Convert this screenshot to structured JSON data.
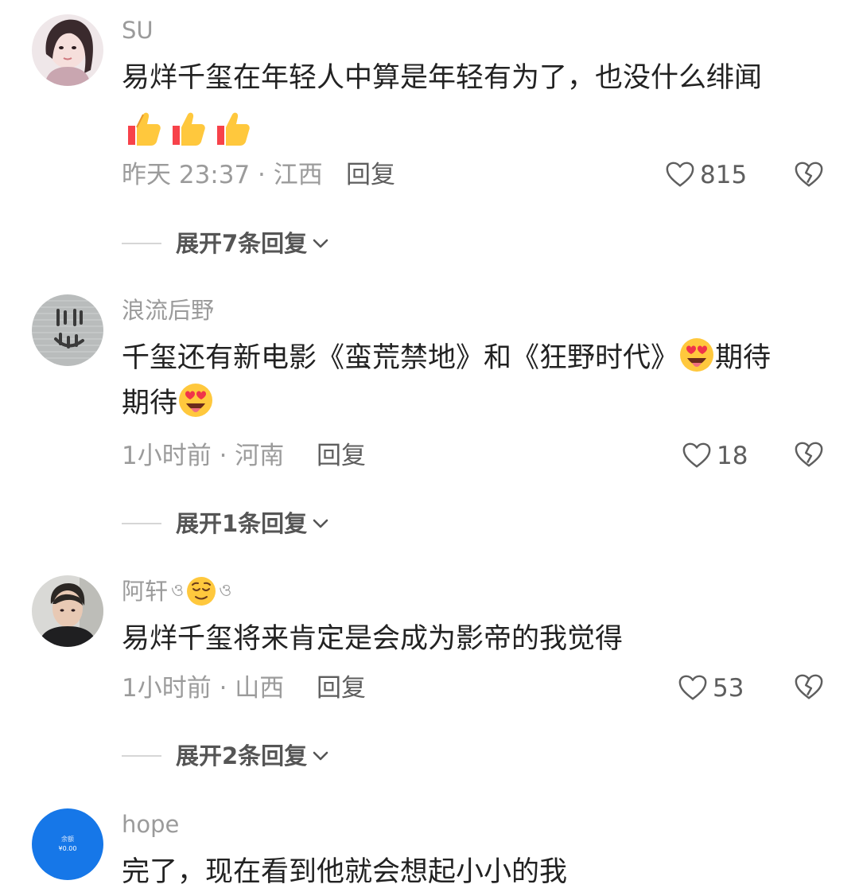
{
  "comments": [
    {
      "username": "SU",
      "text": "易烊千玺在年轻人中算是年轻有为了，也没什么绯闻",
      "emoji_line": "👍👍👍",
      "time_location": "昨天 23:37 · 江西",
      "reply_label": "回复",
      "likes": "815",
      "expand_label": "展开7条回复"
    },
    {
      "username": "浪流后野",
      "text_line1": "千玺还有新电影《蛮荒禁地》和《狂野时代》",
      "text_line1_tail": "期待",
      "text_line2": "期待",
      "time_location": "1小时前 · 河南",
      "reply_label": "回复",
      "likes": "18",
      "expand_label": "展开1条回复"
    },
    {
      "username": "阿轩",
      "username_deco_left": "ও",
      "username_deco_right": "ও",
      "text": "易烊千玺将来肯定是会成为影帝的我觉得",
      "time_location": "1小时前 · 山西",
      "reply_label": "回复",
      "likes": "53",
      "expand_label": "展开2条回复"
    },
    {
      "username": "hope",
      "avatar_text_1": "余额",
      "avatar_text_2": "¥0.00",
      "text": "完了，现在看到他就会想起小小的我"
    }
  ],
  "colors": {
    "username": "#9b9b9b",
    "text": "#222222",
    "meta": "#9b9b9b",
    "action": "#5e5e5e",
    "hope_avatar_bg": "#1677e8"
  },
  "icons": [
    "thumbs-up-emoji",
    "heart-eyes-emoji",
    "relieved-emoji",
    "heart-outline-icon",
    "broken-heart-icon",
    "chevron-down-icon"
  ]
}
